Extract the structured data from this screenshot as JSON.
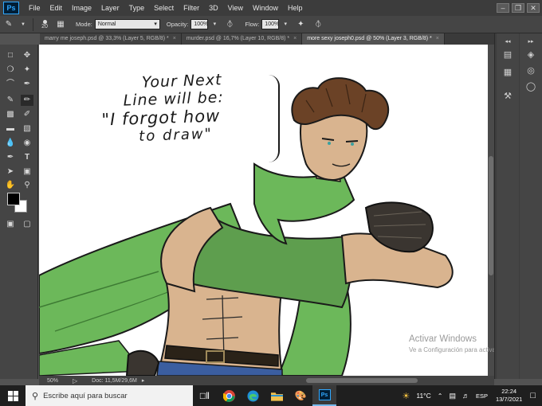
{
  "app": {
    "logo": "Ps"
  },
  "menu": [
    "File",
    "Edit",
    "Image",
    "Layer",
    "Type",
    "Select",
    "Filter",
    "3D",
    "View",
    "Window",
    "Help"
  ],
  "window_controls": {
    "minimize": "–",
    "restore": "❐",
    "close": "✕"
  },
  "options": {
    "brush_size": "20",
    "mode_label": "Mode:",
    "mode_value": "Normal",
    "opacity_label": "Opacity:",
    "opacity_value": "100%",
    "flow_label": "Flow:",
    "flow_value": "100%"
  },
  "tabs": [
    {
      "label": "marry me joseph.psd @ 33,3% (Layer 5, RGB/8) *",
      "close": "×"
    },
    {
      "label": "murder.psd @ 16,7% (Layer 10, RGB/8) *",
      "close": "×"
    },
    {
      "label": "more sexy joseph0.psd @ 50% (Layer 3, RGB/8) *",
      "close": "×"
    }
  ],
  "canvas_text": [
    "Your Next",
    "Line will be:",
    "\"I forgot how",
    "to draw\""
  ],
  "status": {
    "zoom": "50%",
    "doc": "Doc: 11,5M/29,6M"
  },
  "watermark": {
    "title": "Activar Windows",
    "subtitle": "Ve a Configuración para activar Windows."
  },
  "taskbar": {
    "search_placeholder": "Escribe aquí para buscar",
    "temperature": "11°C",
    "language": "ESP",
    "time": "22:24",
    "date": "13/7/2021"
  },
  "colors": {
    "accent": "#31a8ff",
    "scarf_green": "#6cb85a",
    "skin": "#d9b48f",
    "hair": "#6b4226"
  }
}
